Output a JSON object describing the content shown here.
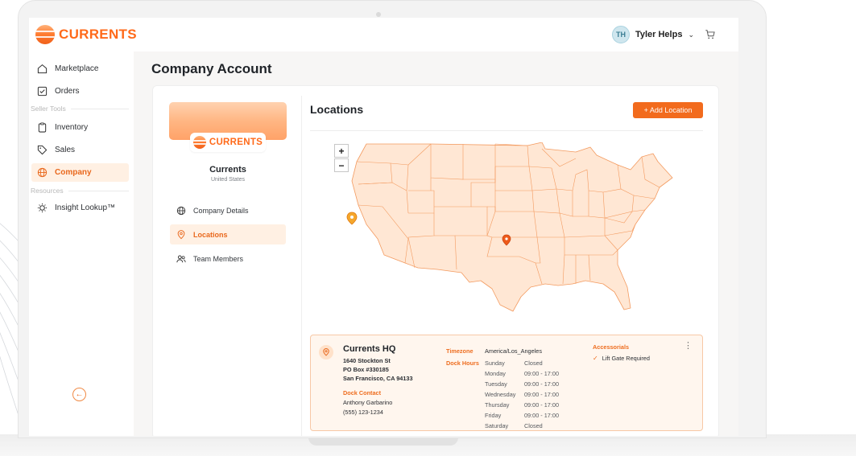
{
  "app": {
    "brand": "CURRENTS"
  },
  "user": {
    "initials": "TH",
    "name": "Tyler Helps"
  },
  "sidebar": {
    "items": [
      {
        "label": "Marketplace",
        "icon": "home-icon"
      },
      {
        "label": "Orders",
        "icon": "checkbox-icon"
      }
    ],
    "seller_tools_label": "Seller Tools",
    "seller_items": [
      {
        "label": "Inventory",
        "icon": "clipboard-icon"
      },
      {
        "label": "Sales",
        "icon": "tag-icon"
      },
      {
        "label": "Company",
        "icon": "globe-icon",
        "active": true
      }
    ],
    "resources_label": "Resources",
    "resource_items": [
      {
        "label": "Insight Lookup™",
        "icon": "lightbulb-icon"
      }
    ]
  },
  "page": {
    "title": "Company Account"
  },
  "profile": {
    "brand": "CURRENTS",
    "name": "Currents",
    "country": "United States",
    "menu": [
      {
        "label": "Company Details",
        "icon": "globe-icon"
      },
      {
        "label": "Locations",
        "icon": "map-pin-icon",
        "active": true
      },
      {
        "label": "Team Members",
        "icon": "users-icon"
      }
    ]
  },
  "locations": {
    "title": "Locations",
    "add_button": "+ Add Location",
    "zoom_in": "+",
    "zoom_out": "−",
    "card": {
      "name": "Currents HQ",
      "address_lines": [
        "1640 Stockton St",
        "PO Box #330185",
        "San Francisco, CA 94133"
      ],
      "dock_contact_label": "Dock Contact",
      "dock_contact_name": "Anthony Garbarino",
      "dock_contact_phone": "(555) 123-1234",
      "timezone_label": "Timezone",
      "timezone": "America/Los_Angeles",
      "dock_hours_label": "Dock Hours",
      "hours": [
        {
          "day": "Sunday",
          "time": "Closed"
        },
        {
          "day": "Monday",
          "time": "09:00 - 17:00"
        },
        {
          "day": "Tuesday",
          "time": "09:00 - 17:00"
        },
        {
          "day": "Wednesday",
          "time": "09:00 - 17:00"
        },
        {
          "day": "Thursday",
          "time": "09:00 - 17:00"
        },
        {
          "day": "Friday",
          "time": "09:00 - 17:00"
        },
        {
          "day": "Saturday",
          "time": "Closed"
        }
      ],
      "accessorials_label": "Accessorials",
      "accessorials": [
        "Lift Gate Required"
      ]
    }
  },
  "colors": {
    "accent": "#f26b1d",
    "accent_light": "#fff0e3",
    "map_fill": "#ffe7d4",
    "map_stroke": "#f39a5f"
  }
}
